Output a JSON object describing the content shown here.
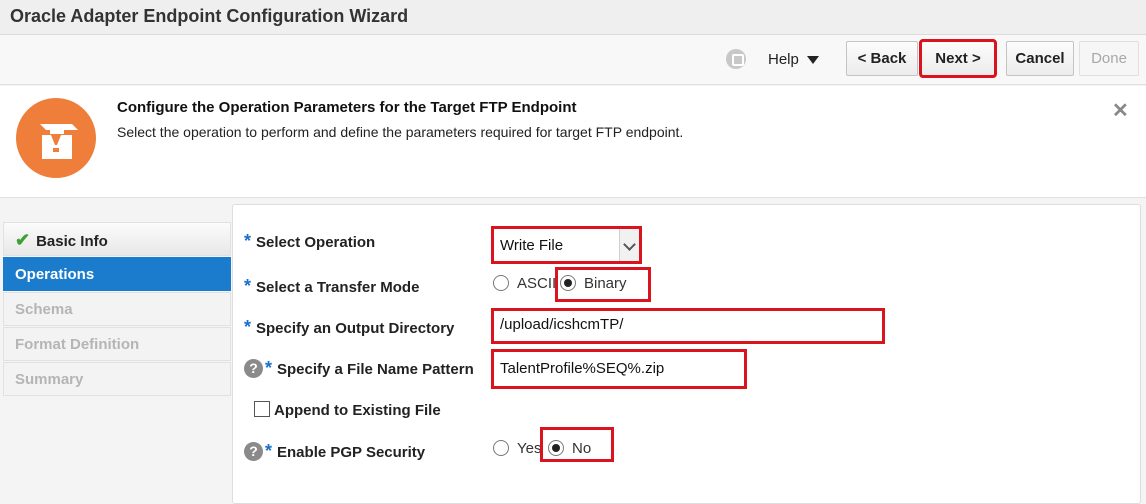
{
  "window": {
    "title": "Oracle Adapter Endpoint Configuration Wizard"
  },
  "toolbar": {
    "help_label": "Help",
    "back_label": "< Back",
    "next_label": "Next >",
    "cancel_label": "Cancel",
    "done_label": "Done"
  },
  "banner": {
    "title": "Configure the Operation Parameters for the Target FTP Endpoint",
    "description": "Select the operation to perform and define the parameters required for target FTP endpoint.",
    "close_glyph": "✕",
    "icon": "adapter-icon",
    "accent": "#ef7e3b"
  },
  "nav": {
    "items": [
      {
        "label": "Basic Info",
        "state": "done"
      },
      {
        "label": "Operations",
        "state": "active"
      },
      {
        "label": "Schema",
        "state": "disabled"
      },
      {
        "label": "Format Definition",
        "state": "disabled"
      },
      {
        "label": "Summary",
        "state": "disabled"
      }
    ],
    "active_color": "#1b7ccd"
  },
  "form": {
    "required_mark": "*",
    "help_mark": "?",
    "select_operation": {
      "label": "Select Operation",
      "value": "Write File"
    },
    "transfer_mode": {
      "label": "Select a Transfer Mode",
      "options": [
        "ASCII",
        "Binary"
      ],
      "selected": "Binary"
    },
    "output_directory": {
      "label": "Specify an Output Directory",
      "value": "/upload/icshcmTP/"
    },
    "file_name_pattern": {
      "label": "Specify a File Name Pattern",
      "value": "TalentProfile%SEQ%.zip"
    },
    "append": {
      "label": "Append to Existing File",
      "checked": false
    },
    "pgp": {
      "label": "Enable PGP Security",
      "options": [
        "Yes",
        "No"
      ],
      "selected": "No"
    }
  },
  "highlight_color": "#d9141e"
}
